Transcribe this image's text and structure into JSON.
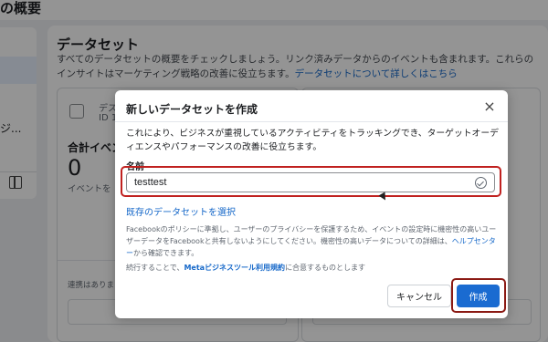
{
  "background": {
    "page_title": "の概要",
    "left_panel_text": "ジ...",
    "dataset_section": {
      "title": "データセット",
      "description": "すべてのデータセットの概要をチェックしましょう。リンク済みデータからのイベントも含まれます。これらのインサイトはマーケティング戦略の改善に役立ちます。",
      "link": "データセットについて詳しくはこちら"
    },
    "card": {
      "name": "デス",
      "id": "ID 1",
      "metric_label": "合計イベン",
      "metric_value": "0",
      "metric_sub": "イベントを",
      "note": "連携はありま"
    }
  },
  "modal": {
    "title": "新しいデータセットを作成",
    "close_label": "×",
    "description": "これにより、ビジネスが重視しているアクティビティをトラッキングでき、ターゲットオーディエンスやパフォーマンスの改善に役立ちます。",
    "name_label": "名前",
    "name_value": "testtest",
    "select_existing": "既存のデータセットを選択",
    "policy_text": "Facebookのポリシーに準拠し、ユーザーのプライバシーを保護するため、イベントの設定時に機密性の高いユーザーデータをFacebookと共有しないようにしてください。機密性の高いデータについての詳細は、",
    "policy_link": "ヘルプセンター",
    "policy_suffix": "から確認できます。",
    "terms_prefix": "続行することで、",
    "terms_link": "Metaビジネスツール利用規約",
    "terms_suffix": "に合意するものとします",
    "cancel_label": "キャンセル",
    "create_label": "作成"
  },
  "colors": {
    "primary": "#1a6bd1",
    "highlight_red": "#c0211f",
    "link": "#1668c9"
  }
}
